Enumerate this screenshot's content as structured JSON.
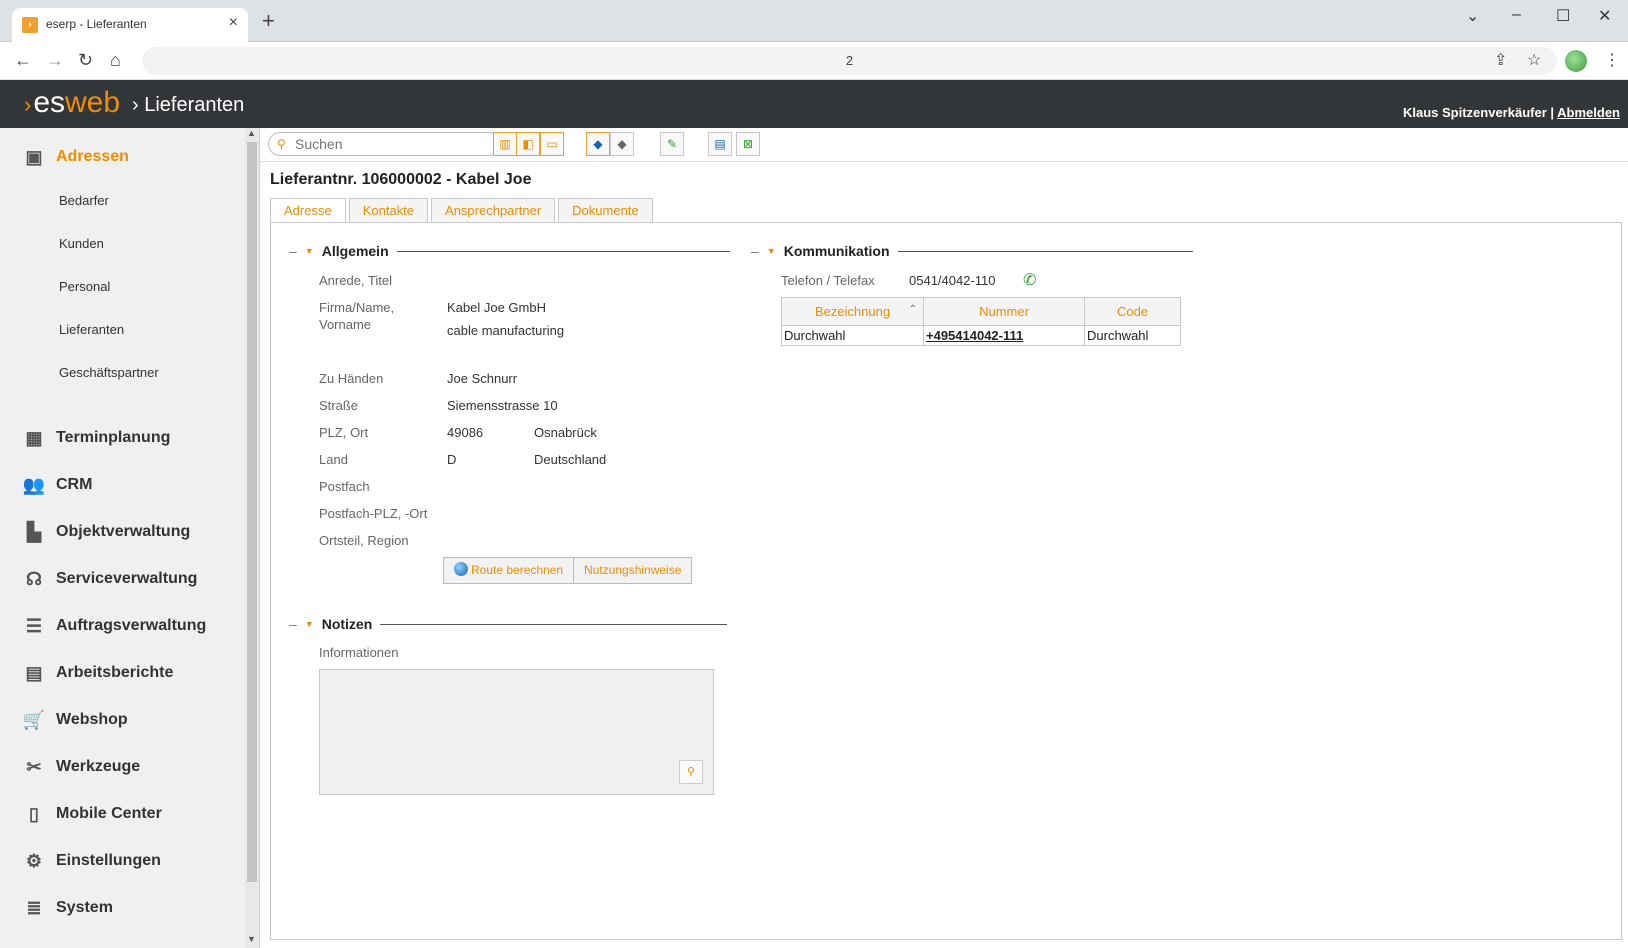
{
  "browser": {
    "tab_title": "eserp - Lieferanten",
    "url": "2"
  },
  "app": {
    "logo_es": "es",
    "logo_web": "web",
    "breadcrumb": "Lieferanten",
    "user": "Klaus Spitzenverkäufer |",
    "logout": "Abmelden"
  },
  "sidebar": {
    "adressen": "Adressen",
    "sub": [
      "Bedarfer",
      "Kunden",
      "Personal",
      "Lieferanten",
      "Geschäftspartner"
    ],
    "main": [
      "Terminplanung",
      "CRM",
      "Objektverwaltung",
      "Serviceverwaltung",
      "Auftragsverwaltung",
      "Arbeitsberichte",
      "Webshop",
      "Werkzeuge",
      "Mobile Center",
      "Einstellungen",
      "System"
    ]
  },
  "search": {
    "placeholder": "Suchen"
  },
  "record": {
    "title": "Lieferantnr. 106000002 - Kabel Joe",
    "tabs": [
      "Adresse",
      "Kontakte",
      "Ansprechpartner",
      "Dokumente"
    ]
  },
  "allgemein": {
    "heading": "Allgemein",
    "anrede_label": "Anrede, Titel",
    "firma_label1": "Firma/Name,",
    "firma_label2": "Vorname",
    "firma_value1": "Kabel Joe GmbH",
    "firma_value2": "cable manufacturing",
    "zuhaenden_label": "Zu Händen",
    "zuhaenden_value": "Joe Schnurr",
    "strasse_label": "Straße",
    "strasse_value": "Siemensstrasse 10",
    "plz_label": "PLZ, Ort",
    "plz_value": "49086",
    "ort_value": "Osnabrück",
    "land_label": "Land",
    "land_code": "D",
    "land_value": "Deutschland",
    "postfach_label": "Postfach",
    "postfach_plz_label": "Postfach-PLZ, -Ort",
    "ortsteil_label": "Ortsteil, Region",
    "route_button": "Route berechnen",
    "hints_button": "Nutzungshinweise"
  },
  "notizen": {
    "heading": "Notizen",
    "info_label": "Informationen"
  },
  "kommunikation": {
    "heading": "Kommunikation",
    "tel_label": "Telefon / Telefax",
    "tel_value": "0541/4042-110",
    "columns": [
      "Bezeichnung",
      "Nummer",
      "Code"
    ],
    "rows": [
      {
        "bezeichnung": "Durchwahl",
        "nummer": "+495414042-111",
        "code": "Durchwahl"
      }
    ]
  },
  "colors": {
    "accent": "#f08c00",
    "header": "#333638"
  }
}
